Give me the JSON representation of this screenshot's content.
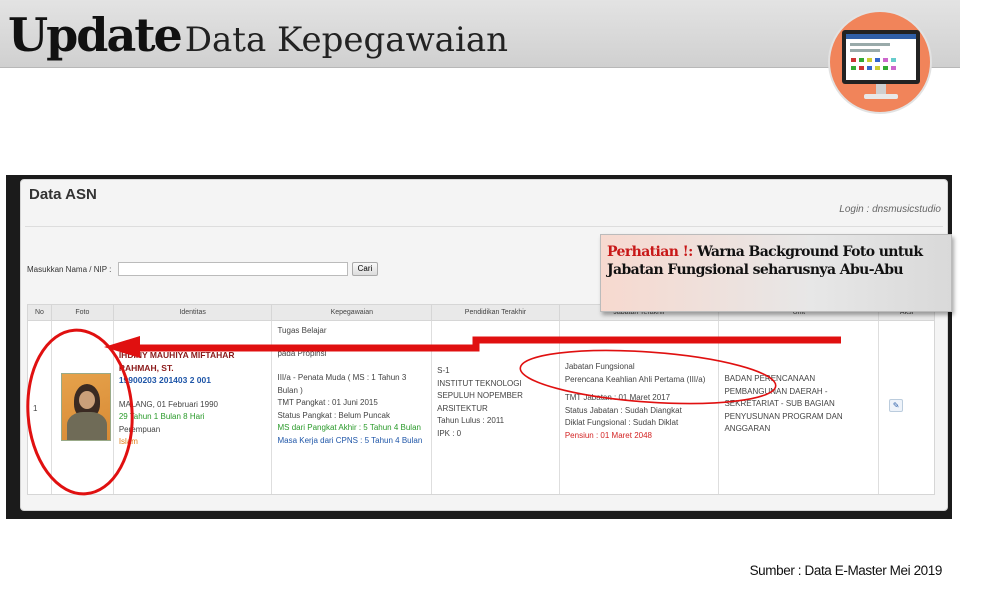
{
  "title": {
    "strong": "Update",
    "light": "Data Kepegawaian"
  },
  "app": {
    "title": "Data ASN",
    "login": "Login : dnsmusicstudio",
    "search": {
      "label": "Masukkan Nama / NIP :",
      "value": "",
      "button": "Cari"
    },
    "columns": [
      "No",
      "Foto",
      "Identitas",
      "Kepegawaian",
      "Pendidikan Terakhir",
      "Jabatan Terakhir",
      "Unit",
      "Aksi"
    ],
    "row": {
      "no": "1",
      "identitas": {
        "name": "IHDINY MAUHIYA MIFTAHAR RAHMAH, ST.",
        "nip": "19900203 201403 2 001",
        "ttl": "MALANG, 01 Februari 1990",
        "umur": "29 Tahun 1 Bulan 8 Hari",
        "gender": "Perempuan",
        "agama": "Islam"
      },
      "kepegawaian": {
        "status": "Tugas Belajar",
        "unit": "pada Propinsi",
        "golongan": "III/a - Penata Muda ( MS : 1 Tahun 3 Bulan )",
        "tmt": "TMT Pangkat : 01 Juni 2015",
        "status_pangkat": "Status Pangkat : Belum Puncak",
        "ms_pangkat": "MS dari Pangkat Akhir : 5 Tahun 4 Bulan",
        "masa_kerja": "Masa Kerja dari CPNS : 5 Tahun 4 Bulan"
      },
      "pendidikan": {
        "jenjang": "S-1",
        "institusi": "INSTITUT TEKNOLOGI SEPULUH NOPEMBER",
        "jurusan": "ARSITEKTUR",
        "lulus": "Tahun Lulus : 2011",
        "ipk": "IPK : 0"
      },
      "jabatan": {
        "jenis": "Jabatan Fungsional",
        "nama": "Perencana Keahlian Ahli Pertama (III/a)",
        "tmt": "TMT Jabatan : 01 Maret 2017",
        "status": "Status Jabatan : Sudah Diangkat",
        "diklat": "Diklat Fungsional : Sudah Diklat",
        "pensiun": "Pensiun : 01 Maret 2048"
      },
      "unit": "BADAN PERENCANAAN PEMBANGUNAN DAERAH - SEKRETARIAT - SUB BAGIAN PENYUSUNAN PROGRAM DAN ANGGARAN",
      "aksi_icon": "edit-icon"
    }
  },
  "note": {
    "warn": "Perhatian !:",
    "text": " Warna Background Foto untuk Jabatan Fungsional seharusnya Abu-Abu"
  },
  "source": "Sumber : Data E-Master Mei 2019",
  "colors": {
    "annotation": "#e01010",
    "accent": "#f1845a",
    "nip": "#1f56a8",
    "name": "#8b1a1a"
  }
}
